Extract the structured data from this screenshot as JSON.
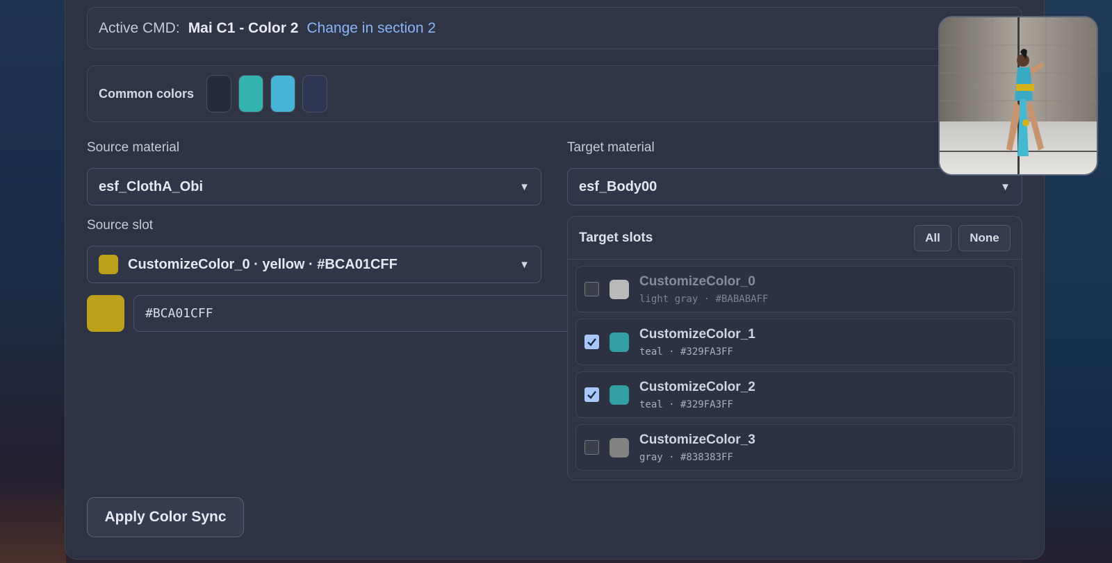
{
  "active": {
    "label": "Active CMD:",
    "value": "Mai C1 - Color 2",
    "link": "Change in section 2"
  },
  "common_colors": {
    "label": "Common colors",
    "swatches": [
      "#262b39",
      "#35b3ad",
      "#47b6d6",
      "#2e3553"
    ]
  },
  "source": {
    "material_label": "Source material",
    "material_value": "esf_ClothA_Obi",
    "slot_label": "Source slot",
    "slot_value": "CustomizeColor_0 · yellow · #BCA01CFF",
    "slot_color": "#bca01c",
    "hex_value": "#BCA01CFF"
  },
  "target": {
    "material_label": "Target material",
    "material_value": "esf_Body00",
    "slots_title": "Target slots",
    "all_label": "All",
    "none_label": "None",
    "slots": [
      {
        "name": "CustomizeColor_0",
        "sub": "light gray · #BABABAFF",
        "color": "#bababa",
        "checked": false,
        "dim": true
      },
      {
        "name": "CustomizeColor_1",
        "sub": "teal · #329FA3FF",
        "color": "#329fa3",
        "checked": true,
        "dim": false
      },
      {
        "name": "CustomizeColor_2",
        "sub": "teal · #329FA3FF",
        "color": "#329fa3",
        "checked": true,
        "dim": false
      },
      {
        "name": "CustomizeColor_3",
        "sub": "gray · #838383FF",
        "color": "#838383",
        "checked": false,
        "dim": false
      }
    ]
  },
  "apply_label": "Apply Color Sync",
  "colors": {
    "accent_link": "#8ab4f8",
    "checkbox_on": "#a8c7fa",
    "panel_bg": "#2d3342"
  }
}
